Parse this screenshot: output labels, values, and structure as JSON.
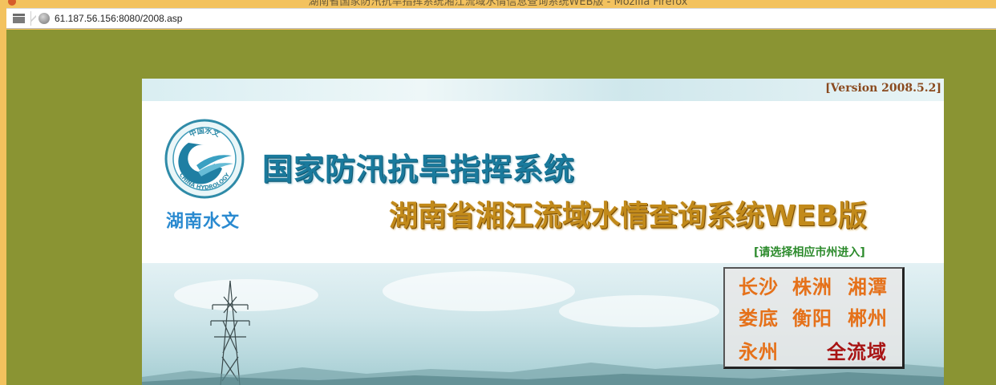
{
  "browser": {
    "window_title": "湖南省国家防汛抗旱指挥系统湘江流域水情信息查询系统WEB版 - Mozilla Firefox",
    "url": "61.187.56.156:8080/2008.asp"
  },
  "header": {
    "version": "[Version 2008.5.2]",
    "logo_ring_top": "中国水文",
    "logo_ring_bottom": "CHINA HYDROLOGY",
    "logo_caption": "湖南水文",
    "title_main": "国家防汛抗旱指挥系统",
    "title_sub": "湖南省湘江流域水情查询系统WEB版",
    "prompt": "[请选择相应市州进入]"
  },
  "cities": [
    {
      "label": "长沙"
    },
    {
      "label": "株洲"
    },
    {
      "label": "湘潭"
    },
    {
      "label": "娄底"
    },
    {
      "label": "衡阳"
    },
    {
      "label": "郴州"
    },
    {
      "label": "永州"
    },
    {
      "label": "全流域"
    }
  ],
  "colors": {
    "page_bg": "#8a9433",
    "title_main": "#1a7a9c",
    "title_sub": "#c28a1a",
    "city_link": "#e5711a",
    "city_all": "#a81414",
    "prompt": "#2b8a2b"
  },
  "icons": {
    "tab_list": "tab-list-icon",
    "site_info": "globe-icon",
    "logo": "china-hydrology-logo"
  }
}
